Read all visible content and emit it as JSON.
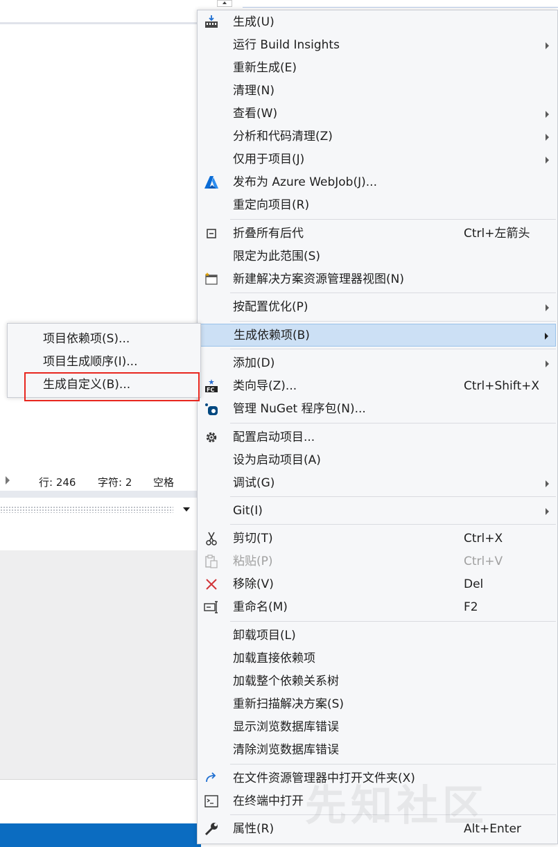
{
  "status_bar": {
    "line": "行: 246",
    "char": "字符: 2",
    "space": "空格"
  },
  "context_menu": {
    "items": [
      {
        "label": "生成(U)",
        "icon": "build-icon"
      },
      {
        "label": "运行 Build Insights",
        "submenu": true
      },
      {
        "label": "重新生成(E)"
      },
      {
        "label": "清理(N)"
      },
      {
        "label": "查看(W)",
        "submenu": true
      },
      {
        "label": "分析和代码清理(Z)",
        "submenu": true
      },
      {
        "label": "仅用于项目(J)",
        "submenu": true
      },
      {
        "label": "发布为 Azure WebJob(J)...",
        "icon": "azure-icon"
      },
      {
        "label": "重定向项目(R)"
      },
      {
        "label": "折叠所有后代",
        "shortcut": "Ctrl+左箭头",
        "icon": "collapse-icon"
      },
      {
        "label": "限定为此范围(S)"
      },
      {
        "label": "新建解决方案资源管理器视图(N)",
        "icon": "new-view-icon"
      },
      {
        "label": "按配置优化(P)",
        "submenu": true
      },
      {
        "label": "生成依赖项(B)",
        "submenu": true,
        "active": true
      },
      {
        "label": "添加(D)",
        "submenu": true
      },
      {
        "label": "类向导(Z)...",
        "shortcut": "Ctrl+Shift+X",
        "icon": "class-wizard-icon"
      },
      {
        "label": "管理 NuGet 程序包(N)...",
        "icon": "nuget-icon"
      },
      {
        "label": "配置启动项目...",
        "icon": "gear-icon"
      },
      {
        "label": "设为启动项目(A)"
      },
      {
        "label": "调试(G)",
        "submenu": true
      },
      {
        "label": "Git(I)",
        "submenu": true
      },
      {
        "label": "剪切(T)",
        "shortcut": "Ctrl+X",
        "icon": "scissors-icon"
      },
      {
        "label": "粘贴(P)",
        "shortcut": "Ctrl+V",
        "icon": "paste-icon",
        "disabled": true
      },
      {
        "label": "移除(V)",
        "shortcut": "Del",
        "icon": "remove-icon"
      },
      {
        "label": "重命名(M)",
        "shortcut": "F2",
        "icon": "rename-icon"
      },
      {
        "label": "卸载项目(L)"
      },
      {
        "label": "加载直接依赖项"
      },
      {
        "label": "加载整个依赖关系树"
      },
      {
        "label": "重新扫描解决方案(S)"
      },
      {
        "label": "显示浏览数据库错误"
      },
      {
        "label": "清除浏览数据库错误"
      },
      {
        "label": "在文件资源管理器中打开文件夹(X)",
        "icon": "open-folder-icon"
      },
      {
        "label": "在终端中打开",
        "icon": "terminal-icon"
      },
      {
        "label": "属性(R)",
        "shortcut": "Alt+Enter",
        "icon": "wrench-icon"
      }
    ]
  },
  "submenu": {
    "items": [
      {
        "label": "项目依赖项(S)..."
      },
      {
        "label": "项目生成顺序(I)..."
      },
      {
        "label": "生成自定义(B)...",
        "highlighted": true
      }
    ]
  },
  "watermark": "先知社区",
  "colors": {
    "active_item_bg": "#cce0f5",
    "highlight_border": "#e8261e",
    "status_bar_blue": "#0b6cc1",
    "remove_icon": "#d13438",
    "azure_icon": "#0a6cd6"
  }
}
